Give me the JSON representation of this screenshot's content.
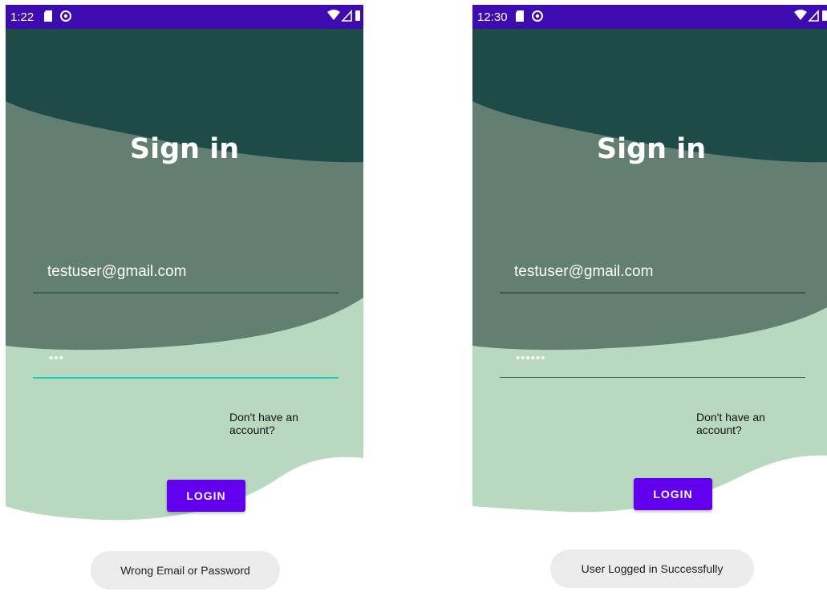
{
  "colors": {
    "status_bar": "#3d0bb0",
    "dark_teal": "#1e4a47",
    "mid_green": "#637f71",
    "light_green": "#b8d8bf",
    "button": "#6200ee",
    "focus_line": "#1bd0b4",
    "toast_bg": "#ebebeb"
  },
  "screens": [
    {
      "status_bar": {
        "time": "1:22",
        "icons": [
          "sd-card-icon",
          "sync-icon"
        ],
        "system_icons": [
          "wifi-icon",
          "signal-icon",
          "battery-icon"
        ]
      },
      "title": "Sign in",
      "email_value": "testuser@gmail.com",
      "password_value": "•••",
      "password_focused": true,
      "signup_text": "Don't have an account?",
      "login_label": "LOGIN",
      "toast": "Wrong Email or Password"
    },
    {
      "status_bar": {
        "time": "12:30",
        "icons": [
          "sd-card-icon",
          "sync-icon"
        ],
        "system_icons": [
          "wifi-icon",
          "signal-icon",
          "battery-icon"
        ]
      },
      "title": "Sign in",
      "email_value": "testuser@gmail.com",
      "password_value": "••••••",
      "password_focused": false,
      "signup_text": "Don't have an account?",
      "login_label": "LOGIN",
      "toast": "User Logged in Successfully"
    }
  ]
}
